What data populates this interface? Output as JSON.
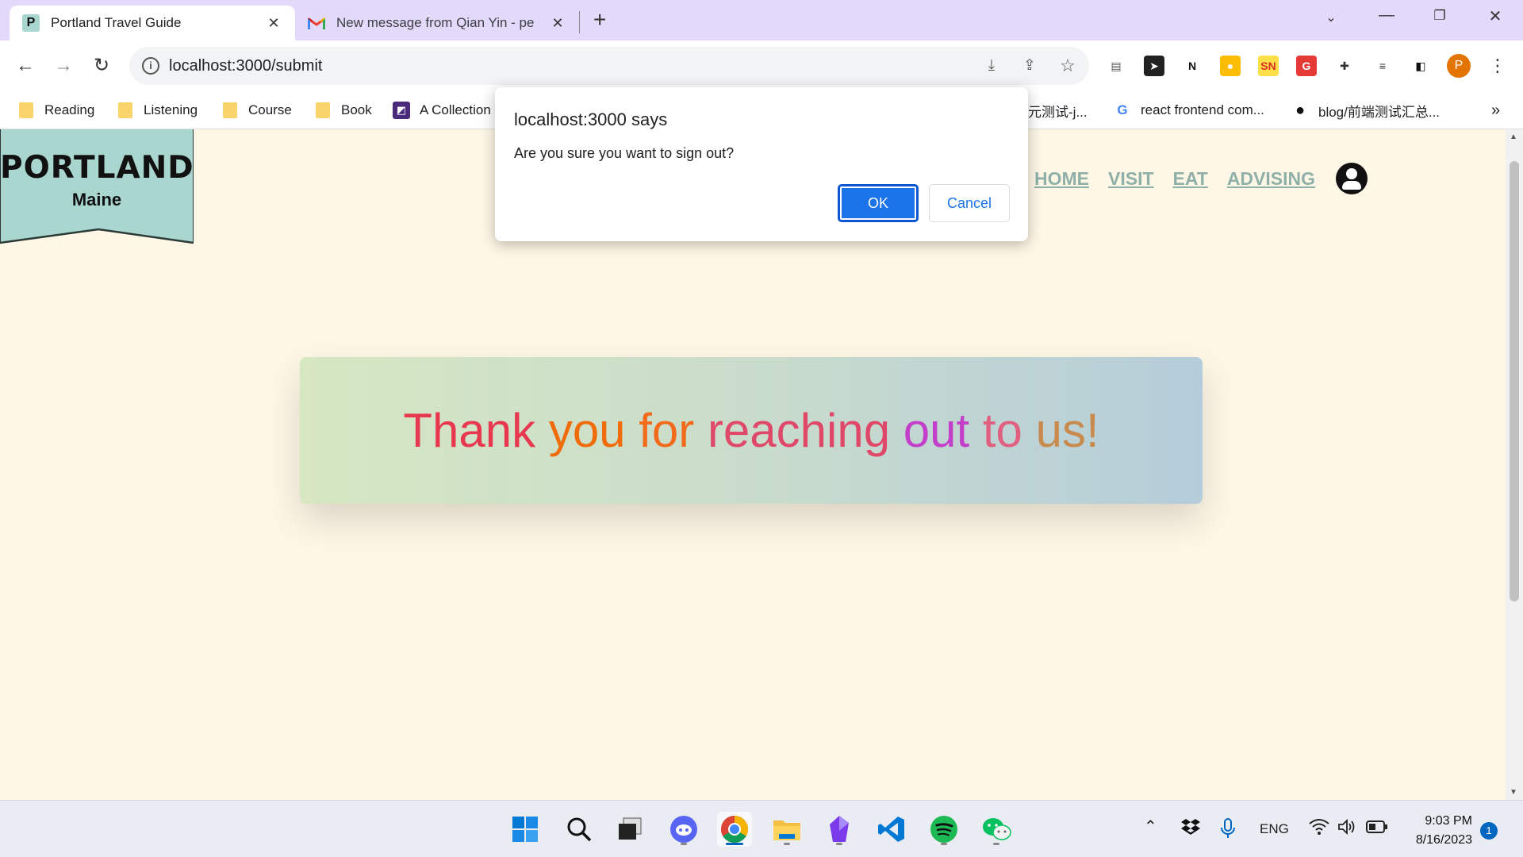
{
  "browser": {
    "tabs": [
      {
        "favicon": "P",
        "title": "Portland Travel Guide"
      },
      {
        "favicon": "M",
        "title": "New message from Qian Yin - pe"
      }
    ],
    "new_tab": "+",
    "url": "localhost:3000/submit",
    "profile_initial": "P",
    "extensions": [
      {
        "icon": "document-icon",
        "glyph": "▤",
        "bg": "#ffffff",
        "color": "#555555"
      },
      {
        "icon": "send-icon",
        "glyph": "➤",
        "bg": "#222222",
        "color": "#ffffff"
      },
      {
        "icon": "notion-icon",
        "glyph": "N",
        "bg": "#ffffff",
        "color": "#111111"
      },
      {
        "icon": "bulb-icon",
        "glyph": "●",
        "bg": "#fbbc04",
        "color": "#ffffff"
      },
      {
        "icon": "sn-icon",
        "glyph": "SN",
        "bg": "#fde047",
        "color": "#d93025"
      },
      {
        "icon": "grammarly-icon",
        "glyph": "G",
        "bg": "#e53935",
        "color": "#ffffff"
      },
      {
        "icon": "puzzle-icon",
        "glyph": "✚",
        "bg": "#ffffff",
        "color": "#333333"
      },
      {
        "icon": "playlist-icon",
        "glyph": "≡",
        "bg": "#ffffff",
        "color": "#333333"
      },
      {
        "icon": "sidepanel-icon",
        "glyph": "◧",
        "bg": "#ffffff",
        "color": "#111111"
      }
    ]
  },
  "bookmarks": [
    {
      "type": "folder",
      "label": "Reading"
    },
    {
      "type": "folder",
      "label": "Listening"
    },
    {
      "type": "folder",
      "label": "Course"
    },
    {
      "type": "folder",
      "label": "Book"
    },
    {
      "type": "site",
      "favicon": "◩",
      "label": "A Collection"
    },
    {
      "type": "site",
      "favicon": "",
      "label": "元测试-j..."
    },
    {
      "type": "site",
      "favicon": "G",
      "label": "react frontend com..."
    },
    {
      "type": "site",
      "favicon": "●",
      "label": "blog/前端测试汇总..."
    }
  ],
  "bookmarks_more": "»",
  "page": {
    "logo_title": "PORTLAND",
    "logo_subtitle": "Maine",
    "nav": [
      "HOME",
      "VISIT",
      "EAT",
      "ADVISING"
    ],
    "thanks_words": [
      {
        "text": "Thank",
        "color": "#e8384f"
      },
      {
        "text": "you",
        "color": "#f06b0a"
      },
      {
        "text": "for",
        "color": "#f26b1d"
      },
      {
        "text": "reaching",
        "color": "#e0486a"
      },
      {
        "text": "out",
        "color": "#c33fc9"
      },
      {
        "text": "to",
        "color": "#e15f7f"
      },
      {
        "text": "us!",
        "color": "#c98a4e"
      }
    ]
  },
  "dialog": {
    "title": "localhost:3000 says",
    "message": "Are you sure you want to sign out?",
    "ok_label": "OK",
    "cancel_label": "Cancel"
  },
  "taskbar": {
    "apps": [
      {
        "icon": "windows-start-icon"
      },
      {
        "icon": "search-icon"
      },
      {
        "icon": "task-view-icon"
      },
      {
        "icon": "discord-icon"
      },
      {
        "icon": "chrome-icon"
      },
      {
        "icon": "file-explorer-icon"
      },
      {
        "icon": "obsidian-icon"
      },
      {
        "icon": "vscode-icon"
      },
      {
        "icon": "spotify-icon"
      },
      {
        "icon": "wechat-icon"
      }
    ],
    "language": "ENG",
    "time": "9:03 PM",
    "date": "8/16/2023",
    "notification_count": "1"
  }
}
